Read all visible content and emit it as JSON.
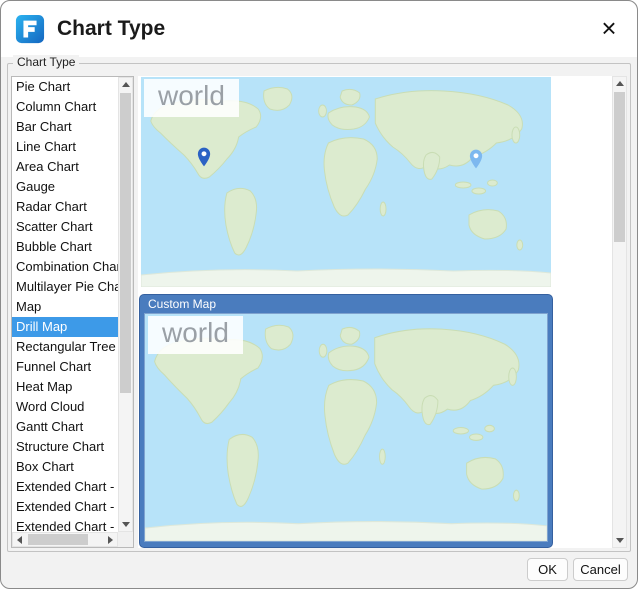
{
  "window": {
    "title": "Chart Type",
    "close_glyph": "×"
  },
  "group_label": "Chart Type",
  "list": {
    "items": [
      {
        "label": "Pie Chart",
        "selected": false
      },
      {
        "label": "Column Chart",
        "selected": false
      },
      {
        "label": "Bar Chart",
        "selected": false
      },
      {
        "label": "Line Chart",
        "selected": false
      },
      {
        "label": "Area Chart",
        "selected": false
      },
      {
        "label": "Gauge",
        "selected": false
      },
      {
        "label": "Radar Chart",
        "selected": false
      },
      {
        "label": "Scatter Chart",
        "selected": false
      },
      {
        "label": "Bubble Chart",
        "selected": false
      },
      {
        "label": "Combination Chart",
        "selected": false
      },
      {
        "label": "Multilayer Pie Chart",
        "selected": false
      },
      {
        "label": "Map",
        "selected": false
      },
      {
        "label": "Drill Map",
        "selected": true
      },
      {
        "label": "Rectangular Tree Diagram",
        "selected": false
      },
      {
        "label": "Funnel Chart",
        "selected": false
      },
      {
        "label": "Heat Map",
        "selected": false
      },
      {
        "label": "Word Cloud",
        "selected": false
      },
      {
        "label": "Gantt Chart",
        "selected": false
      },
      {
        "label": "Structure Chart",
        "selected": false
      },
      {
        "label": "Box Chart",
        "selected": false
      },
      {
        "label": "Extended Chart -",
        "selected": false
      },
      {
        "label": "Extended Chart -",
        "selected": false
      },
      {
        "label": "Extended Chart -",
        "selected": false
      }
    ]
  },
  "preview": {
    "map1": {
      "watermark": "world"
    },
    "map2": {
      "watermark": "world",
      "panel_title": "Custom Map",
      "selected": true
    }
  },
  "buttons": {
    "ok": "OK",
    "cancel": "Cancel"
  },
  "colors": {
    "accent_blue": "#1e88e5",
    "selection_blue": "#3d9ae8",
    "ocean": "#b7e3f9",
    "land": "#dcebcf",
    "land_border": "#c9ddb4",
    "panel_blue": "#4a7cbe",
    "pin_dark": "#2b62c4",
    "pin_light": "#7db8ef",
    "antarctica": "#eef5ec",
    "watermark_text": "#9aa0a6"
  }
}
